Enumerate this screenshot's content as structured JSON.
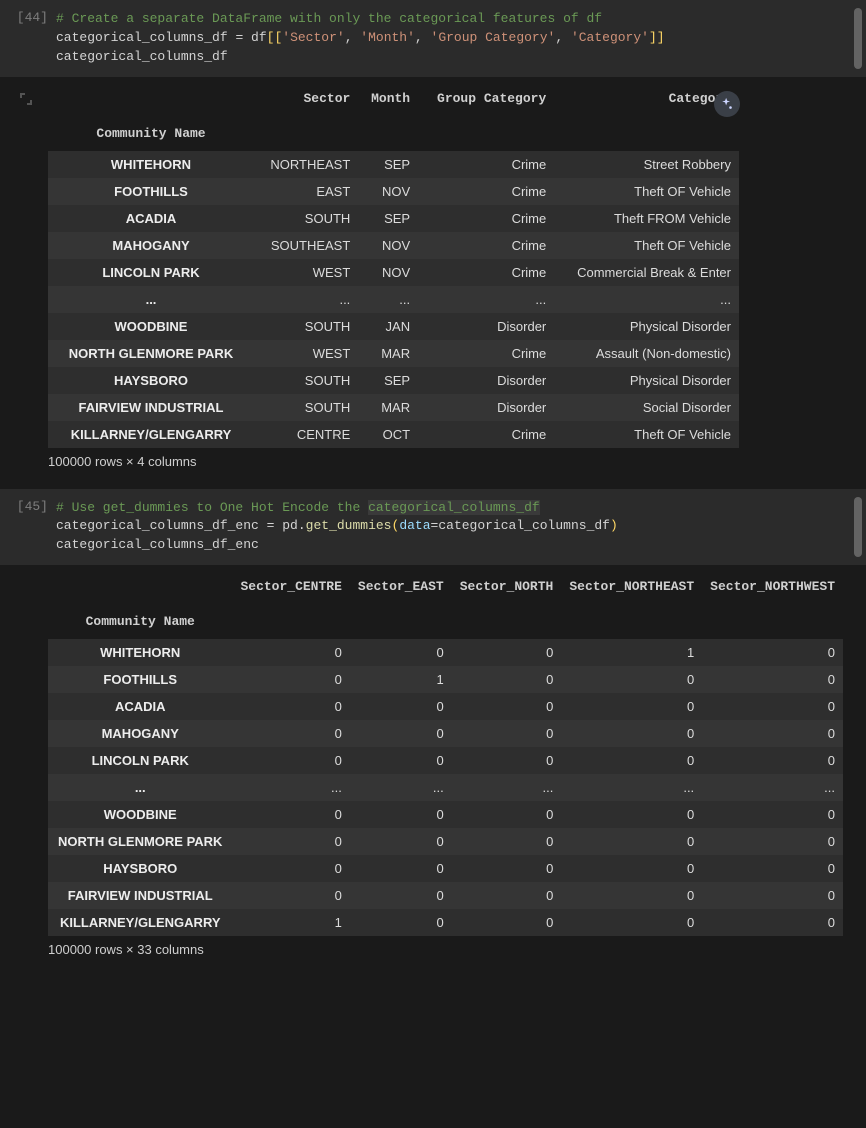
{
  "cell1": {
    "prompt": "[44]",
    "comment": "# Create a separate DataFrame with only the categorical features of df",
    "line2_lhs": "categorical_columns_df",
    "line2_eq": " = ",
    "line2_df": "df",
    "line2_strings": [
      "'Sector'",
      "'Month'",
      "'Group Category'",
      "'Category'"
    ],
    "line3": "categorical_columns_df"
  },
  "df1": {
    "index_name": "Community Name",
    "columns": [
      "Sector",
      "Month",
      "Group Category",
      "Category"
    ],
    "rows": [
      {
        "idx": "WHITEHORN",
        "vals": [
          "NORTHEAST",
          "SEP",
          "Crime",
          "Street Robbery"
        ]
      },
      {
        "idx": "FOOTHILLS",
        "vals": [
          "EAST",
          "NOV",
          "Crime",
          "Theft OF Vehicle"
        ]
      },
      {
        "idx": "ACADIA",
        "vals": [
          "SOUTH",
          "SEP",
          "Crime",
          "Theft FROM Vehicle"
        ]
      },
      {
        "idx": "MAHOGANY",
        "vals": [
          "SOUTHEAST",
          "NOV",
          "Crime",
          "Theft OF Vehicle"
        ]
      },
      {
        "idx": "LINCOLN PARK",
        "vals": [
          "WEST",
          "NOV",
          "Crime",
          "Commercial Break & Enter"
        ]
      }
    ],
    "ellipsis": "...",
    "rows_tail": [
      {
        "idx": "WOODBINE",
        "vals": [
          "SOUTH",
          "JAN",
          "Disorder",
          "Physical Disorder"
        ]
      },
      {
        "idx": "NORTH GLENMORE PARK",
        "vals": [
          "WEST",
          "MAR",
          "Crime",
          "Assault (Non-domestic)"
        ]
      },
      {
        "idx": "HAYSBORO",
        "vals": [
          "SOUTH",
          "SEP",
          "Disorder",
          "Physical Disorder"
        ]
      },
      {
        "idx": "FAIRVIEW INDUSTRIAL",
        "vals": [
          "SOUTH",
          "MAR",
          "Disorder",
          "Social Disorder"
        ]
      },
      {
        "idx": "KILLARNEY/GLENGARRY",
        "vals": [
          "CENTRE",
          "OCT",
          "Crime",
          "Theft OF Vehicle"
        ]
      }
    ],
    "shape": "100000 rows × 4 columns"
  },
  "cell2": {
    "prompt": "[45]",
    "comment": "# Use get_dummies to One Hot Encode the ",
    "comment_hl": "categorical_columns_df",
    "line2_lhs": "categorical_columns_df_enc",
    "line2_eq": " = ",
    "line2_mod": "pd",
    "line2_func": "get_dummies",
    "line2_param": "data",
    "line2_arg": "categorical_columns_df",
    "line3": "categorical_columns_df_enc"
  },
  "df2": {
    "index_name": "Community Name",
    "columns": [
      "Sector_CENTRE",
      "Sector_EAST",
      "Sector_NORTH",
      "Sector_NORTHEAST",
      "Sector_NORTHWEST"
    ],
    "rows": [
      {
        "idx": "WHITEHORN",
        "vals": [
          "0",
          "0",
          "0",
          "1",
          "0"
        ]
      },
      {
        "idx": "FOOTHILLS",
        "vals": [
          "0",
          "1",
          "0",
          "0",
          "0"
        ]
      },
      {
        "idx": "ACADIA",
        "vals": [
          "0",
          "0",
          "0",
          "0",
          "0"
        ]
      },
      {
        "idx": "MAHOGANY",
        "vals": [
          "0",
          "0",
          "0",
          "0",
          "0"
        ]
      },
      {
        "idx": "LINCOLN PARK",
        "vals": [
          "0",
          "0",
          "0",
          "0",
          "0"
        ]
      }
    ],
    "ellipsis": "...",
    "rows_tail": [
      {
        "idx": "WOODBINE",
        "vals": [
          "0",
          "0",
          "0",
          "0",
          "0"
        ]
      },
      {
        "idx": "NORTH GLENMORE PARK",
        "vals": [
          "0",
          "0",
          "0",
          "0",
          "0"
        ]
      },
      {
        "idx": "HAYSBORO",
        "vals": [
          "0",
          "0",
          "0",
          "0",
          "0"
        ]
      },
      {
        "idx": "FAIRVIEW INDUSTRIAL",
        "vals": [
          "0",
          "0",
          "0",
          "0",
          "0"
        ]
      },
      {
        "idx": "KILLARNEY/GLENGARRY",
        "vals": [
          "1",
          "0",
          "0",
          "0",
          "0"
        ]
      }
    ],
    "shape": "100000 rows × 33 columns"
  },
  "magic_tip": "Suggest charts"
}
